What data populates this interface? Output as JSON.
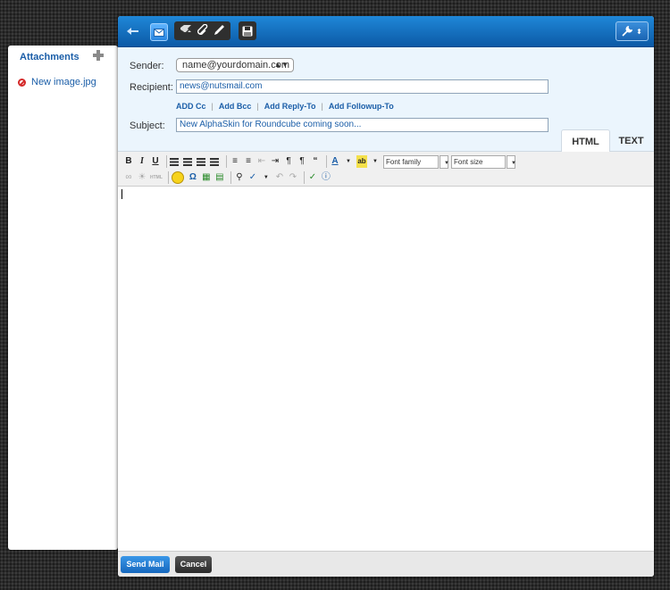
{
  "sidebar": {
    "title": "Attachments",
    "files": [
      {
        "name": "New image.jpg"
      }
    ]
  },
  "toolbar": {
    "back_icon": "arrow-left-icon",
    "mail_icon": "envelope-icon",
    "spellcheck_icon": "spellcheck-icon",
    "attach_icon": "paperclip-icon",
    "signature_icon": "pen-icon",
    "save_icon": "save-icon",
    "settings_icon": "wrench-icon"
  },
  "form": {
    "sender_label": "Sender:",
    "sender_value": "name@yourdomain.com",
    "recipient_label": "Recipient:",
    "recipient_value": "news@nutsmail.com",
    "links": [
      "ADD Cc",
      "Add Bcc",
      "Add Reply-To",
      "Add Followup-To"
    ],
    "subject_label": "Subject:",
    "subject_value": "New AlphaSkin for Roundcube coming soon..."
  },
  "tabs": [
    "HTML",
    "TEXT"
  ],
  "editor": {
    "font_family": "Font family",
    "font_size": "Font size",
    "html_btn": "HTML",
    "bold": "B",
    "italic": "I",
    "underline": "U",
    "text_color": "A",
    "highlight": "ab",
    "omega": "Ω",
    "blockquote": "“"
  },
  "footer": {
    "send": "Send Mail",
    "cancel": "Cancel"
  },
  "colors": {
    "accent": "#1b5ea8",
    "toolbar": "#1577c9",
    "header_bg": "#ebf5fd"
  }
}
